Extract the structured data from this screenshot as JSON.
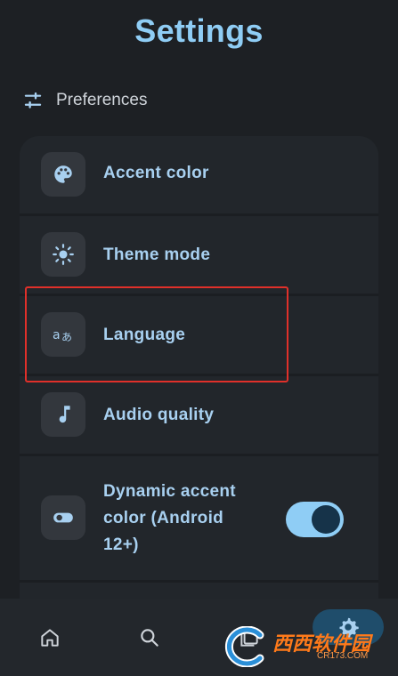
{
  "page": {
    "title": "Settings"
  },
  "section": {
    "label": "Preferences",
    "icon": "sliders-icon"
  },
  "rows": [
    {
      "label": "Accent color",
      "icon": "palette-icon"
    },
    {
      "label": "Theme mode",
      "icon": "sun-icon"
    },
    {
      "label": "Language",
      "icon": "translate-icon"
    },
    {
      "label": "Audio quality",
      "icon": "music-note-icon"
    },
    {
      "label": "Dynamic accent color (Android 12+)",
      "icon": "toggle-icon",
      "toggle_on": true
    }
  ],
  "nav": {
    "items": [
      {
        "icon": "home-icon"
      },
      {
        "icon": "search-icon"
      },
      {
        "icon": "library-icon"
      },
      {
        "icon": "gear-icon",
        "selected": true
      }
    ]
  },
  "watermark": {
    "text": "西西软件园",
    "sub": "CR173.COM"
  },
  "colors": {
    "background": "#1d2024",
    "accent": "#8fcdf5",
    "card": "#22262b",
    "highlight": "#e0302a"
  }
}
